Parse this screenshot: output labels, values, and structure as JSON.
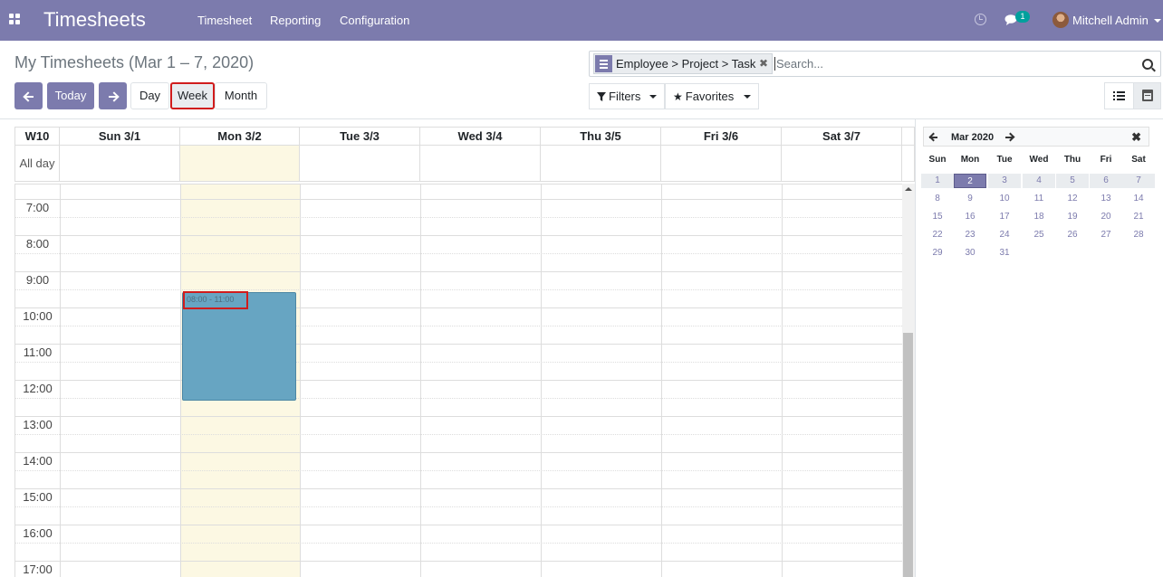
{
  "app": {
    "brand": "Timesheets",
    "menus": [
      "Timesheet",
      "Reporting",
      "Configuration"
    ],
    "messages_badge": "1",
    "user_name": "Mitchell Admin"
  },
  "control_panel": {
    "title": "My Timesheets (Mar 1 – 7, 2020)",
    "today_label": "Today",
    "scales": {
      "day": "Day",
      "week": "Week",
      "month": "Month"
    },
    "active_scale": "Week",
    "search": {
      "facet": "Employee > Project > Task",
      "placeholder": "Search..."
    },
    "filters_label": "Filters",
    "favorites_label": "Favorites"
  },
  "calendar": {
    "week_label": "W10",
    "days": [
      "Sun 3/1",
      "Mon 3/2",
      "Tue 3/3",
      "Wed 3/4",
      "Thu 3/5",
      "Fri 3/6",
      "Sat 3/7"
    ],
    "today_day": "Mon 3/2",
    "all_day_label": "All day",
    "hours": [
      "7:00",
      "8:00",
      "9:00",
      "10:00",
      "11:00",
      "12:00",
      "13:00",
      "14:00",
      "15:00",
      "16:00",
      "17:00"
    ],
    "event": {
      "time": "08:00 - 11:00",
      "day": "Mon 3/2",
      "color": "#67a5c2"
    }
  },
  "mini_calendar": {
    "title": "Mar 2020",
    "weekdays": [
      "Sun",
      "Mon",
      "Tue",
      "Wed",
      "Thu",
      "Fri",
      "Sat"
    ],
    "weeks": [
      [
        "1",
        "2",
        "3",
        "4",
        "5",
        "6",
        "7"
      ],
      [
        "8",
        "9",
        "10",
        "11",
        "12",
        "13",
        "14"
      ],
      [
        "15",
        "16",
        "17",
        "18",
        "19",
        "20",
        "21"
      ],
      [
        "22",
        "23",
        "24",
        "25",
        "26",
        "27",
        "28"
      ],
      [
        "29",
        "30",
        "31",
        "",
        "",
        "",
        ""
      ]
    ],
    "selected": "2"
  },
  "colors": {
    "brand": "#7c7bad",
    "today_highlight": "#fcf8e3",
    "badge": "#00a09d",
    "highlight_border": "#d01c1c"
  },
  "icons": {
    "apps": "apps-grid-icon",
    "clock": "clock-icon",
    "chat": "chat-icon",
    "search": "magnifier-icon",
    "list_view": "list-icon",
    "calendar_view": "calendar-icon"
  }
}
